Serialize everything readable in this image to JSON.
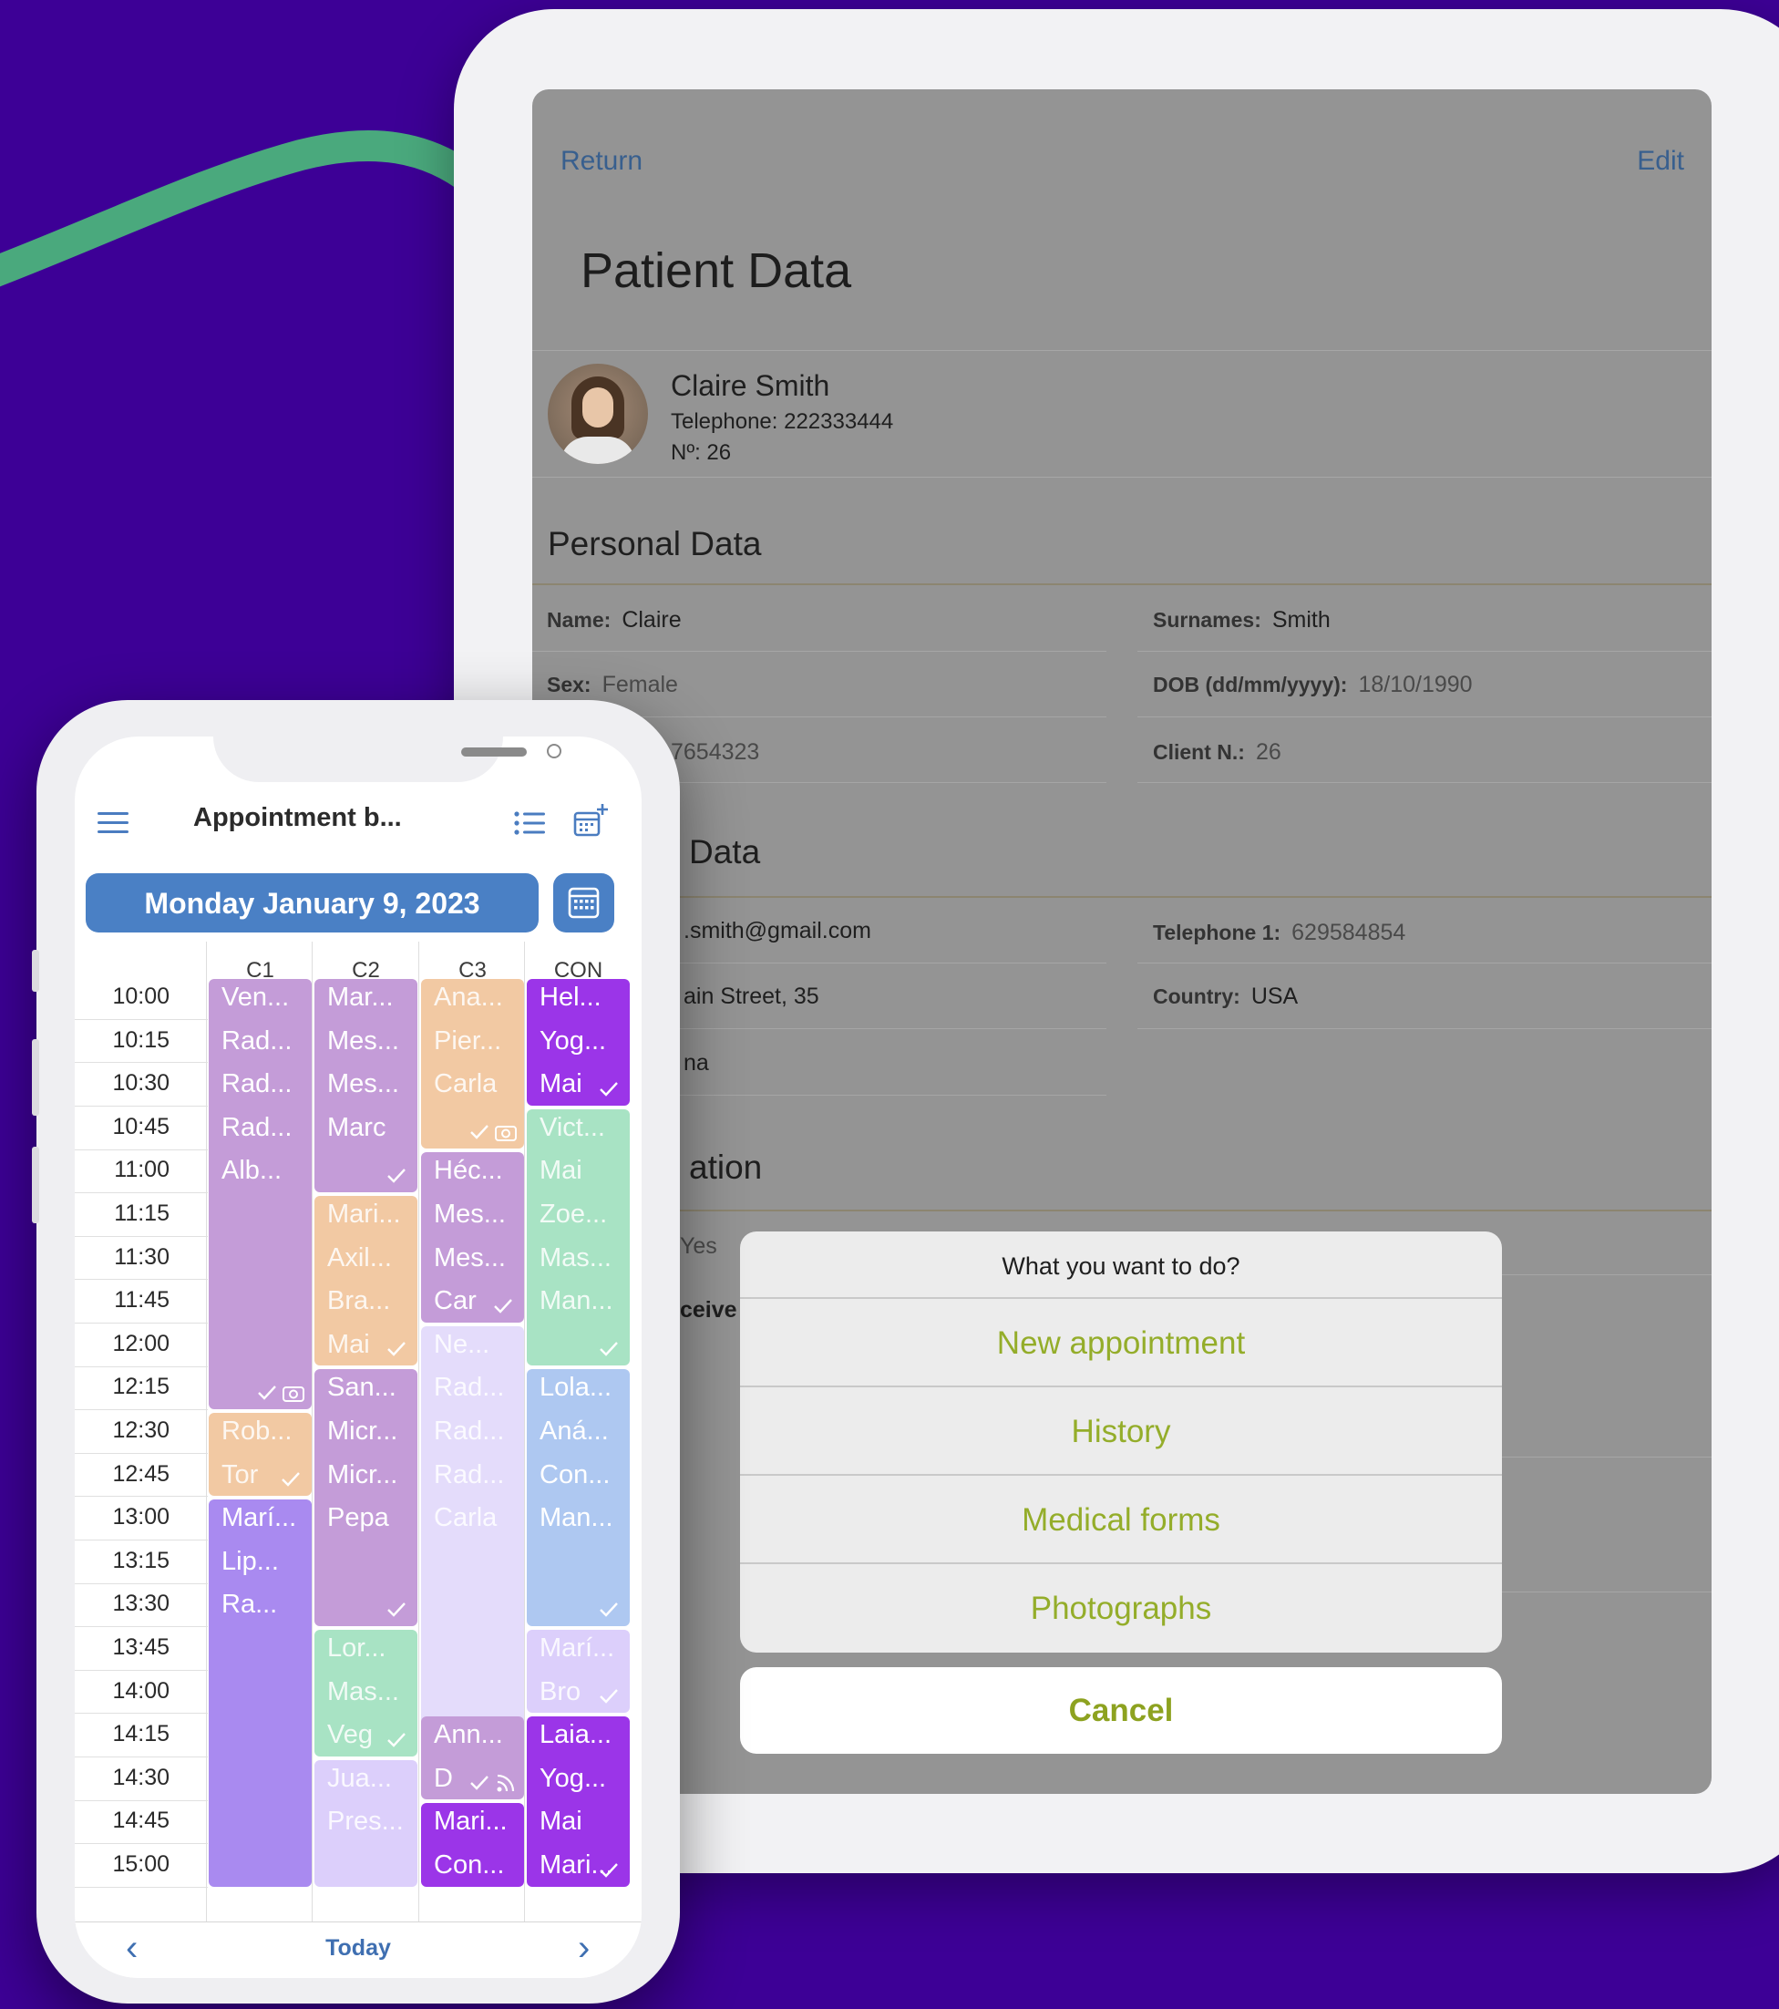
{
  "tablet": {
    "nav": {
      "return_label": "Return",
      "edit_label": "Edit"
    },
    "title": "Patient Data",
    "patient": {
      "name": "Claire Smith",
      "telephone": "Telephone: 222333444",
      "number": "Nº: 26"
    },
    "personal_section": "Personal Data",
    "personal": {
      "name_label": "Name:",
      "name_value": "Claire",
      "surnames_label": "Surnames:",
      "surnames_value": "Smith",
      "sex_label": "Sex:",
      "sex_value": "Female",
      "dob_label": "DOB (dd/mm/yyyy):",
      "dob_value": "18/10/1990",
      "id_partial": "7654323",
      "client_label": "Client N.:",
      "client_value": "26"
    },
    "contact_section_partial": "Data",
    "contact": {
      "email_partial": ".smith@gmail.com",
      "tel1_label": "Telephone 1:",
      "tel1_value": "629584854",
      "address_partial": "ain Street, 35",
      "country_label": "Country:",
      "country_value": "USA",
      "city_partial": "na"
    },
    "third_section_partial": "ation",
    "third": {
      "yes_partial": "Yes",
      "receive_partial": "ceive"
    },
    "action_sheet": {
      "title": "What you want to do?",
      "options": [
        "New appointment",
        "History",
        "Medical forms",
        "Photographs"
      ],
      "cancel": "Cancel"
    }
  },
  "phone": {
    "app_title": "Appointment b...",
    "date": "Monday January 9, 2023",
    "columns": [
      "C1",
      "C2",
      "C3",
      "CON"
    ],
    "times": [
      "10:00",
      "10:15",
      "10:30",
      "10:45",
      "11:00",
      "11:15",
      "11:30",
      "11:45",
      "12:00",
      "12:15",
      "12:30",
      "12:45",
      "13:00",
      "13:15",
      "13:30",
      "13:45",
      "14:00",
      "14:15",
      "14:30",
      "14:45",
      "15:00"
    ],
    "events": [
      {
        "col": 0,
        "start": 0,
        "slots": 10,
        "color": "#c49cd8",
        "labels": [
          "Ven...",
          "Rad...",
          "Rad...",
          "Rad...",
          "Alb..."
        ],
        "check": true,
        "icon": "camera"
      },
      {
        "col": 0,
        "start": 10,
        "slots": 2,
        "color": "#f2c9a3",
        "labels": [
          "Rob...",
          "Tor"
        ],
        "check": true
      },
      {
        "col": 0,
        "start": 12,
        "slots": 9,
        "color": "#a98af0",
        "labels": [
          "Marí...",
          "Lip...",
          "Ra..."
        ]
      },
      {
        "col": 1,
        "start": 0,
        "slots": 5,
        "color": "#c49cd8",
        "labels": [
          "Mar...",
          "Mes...",
          "Mes...",
          "Marc"
        ],
        "check": true
      },
      {
        "col": 1,
        "start": 5,
        "slots": 4,
        "color": "#f2c9a3",
        "labels": [
          "Mari...",
          "Axil...",
          "Bra...",
          "Mai"
        ],
        "check": true
      },
      {
        "col": 1,
        "start": 9,
        "slots": 6,
        "color": "#c49cd8",
        "labels": [
          "San...",
          "Micr...",
          "Micr...",
          "Pepa"
        ],
        "check": true
      },
      {
        "col": 1,
        "start": 15,
        "slots": 3,
        "color": "#a8e3c4",
        "labels": [
          "Lor...",
          "Mas...",
          "Veg"
        ],
        "check": true
      },
      {
        "col": 1,
        "start": 18,
        "slots": 3,
        "color": "#dccffb",
        "labels": [
          "Jua...",
          "Pres..."
        ]
      },
      {
        "col": 2,
        "start": 0,
        "slots": 4,
        "color": "#f2c9a3",
        "labels": [
          "Ana...",
          "Pier...",
          "Carla"
        ],
        "check": true,
        "icon": "camera"
      },
      {
        "col": 2,
        "start": 4,
        "slots": 4,
        "color": "#c49cd8",
        "labels": [
          "Héc...",
          "Mes...",
          "Mes...",
          "Car"
        ],
        "check": true
      },
      {
        "col": 2,
        "start": 8,
        "slots": 10,
        "color": "#e4dcfb",
        "labels": [
          "Ne...",
          "Rad...",
          "Rad...",
          "Rad...",
          "Carla"
        ],
        "check": true
      },
      {
        "col": 2,
        "start": 17,
        "slots": 2,
        "color": "#c49cd8",
        "labels": [
          "Ann...",
          "D"
        ],
        "check": true,
        "icon": "rss"
      },
      {
        "col": 2,
        "start": 19,
        "slots": 2,
        "color": "#9b35e8",
        "labels": [
          "Mari...",
          "Con..."
        ]
      },
      {
        "col": 3,
        "start": 0,
        "slots": 3,
        "color": "#9b35e8",
        "labels": [
          "Hel...",
          "Yog...",
          "Mai"
        ],
        "check": true
      },
      {
        "col": 3,
        "start": 3,
        "slots": 6,
        "color": "#a8e3c4",
        "labels": [
          "Vict...",
          "Mai",
          "Zoe...",
          "Mas...",
          "Man..."
        ],
        "check": true
      },
      {
        "col": 3,
        "start": 9,
        "slots": 6,
        "color": "#aec8f1",
        "labels": [
          "Lola...",
          "Aná...",
          "Con...",
          "Man..."
        ],
        "check": true
      },
      {
        "col": 3,
        "start": 15,
        "slots": 2,
        "color": "#dccffb",
        "labels": [
          "Marí...",
          "Bro"
        ],
        "check": true
      },
      {
        "col": 3,
        "start": 17,
        "slots": 4,
        "color": "#9b35e8",
        "labels": [
          "Laia...",
          "Yog...",
          "Mai",
          "Mari..."
        ],
        "check": true
      }
    ],
    "bottom": {
      "today_label": "Today"
    }
  }
}
